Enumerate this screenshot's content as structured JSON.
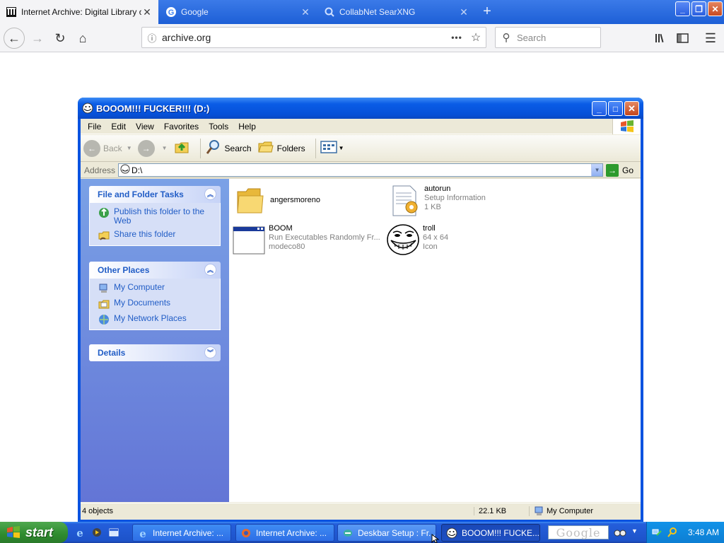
{
  "browser": {
    "tabs": [
      {
        "title": "Internet Archive: Digital Library of",
        "active": true
      },
      {
        "title": "Google",
        "active": false
      },
      {
        "title": "CollabNet SearXNG",
        "active": false
      }
    ],
    "url": "archive.org",
    "search_placeholder": "Search"
  },
  "explorer": {
    "title": "BOOOM!!! FUCKER!!! (D:)",
    "menu": [
      "File",
      "Edit",
      "View",
      "Favorites",
      "Tools",
      "Help"
    ],
    "toolbar": {
      "back": "Back",
      "search": "Search",
      "folders": "Folders"
    },
    "address": {
      "label": "Address",
      "value": "D:\\",
      "go": "Go"
    },
    "panels": {
      "tasks": {
        "title": "File and Folder Tasks",
        "links": [
          "Publish this folder to the Web",
          "Share this folder"
        ]
      },
      "places": {
        "title": "Other Places",
        "links": [
          "My Computer",
          "My Documents",
          "My Network Places"
        ]
      },
      "details": {
        "title": "Details"
      }
    },
    "files": [
      {
        "name": "angersmoreno",
        "line2": "",
        "line3": "",
        "icon": "folder-icon"
      },
      {
        "name": "autorun",
        "line2": "Setup Information",
        "line3": "1 KB",
        "icon": "setup-info-icon"
      },
      {
        "name": "BOOM",
        "line2": "Run Executables Randomly Fr...",
        "line3": "modeco80",
        "icon": "application-icon"
      },
      {
        "name": "troll",
        "line2": "64 x 64",
        "line3": "Icon",
        "icon": "trollface-icon"
      }
    ],
    "status": {
      "objects": "4 objects",
      "size": "22.1 KB",
      "location": "My Computer"
    }
  },
  "taskbar": {
    "start": "start",
    "tasks": [
      {
        "label": "Internet Archive: ...",
        "active": false
      },
      {
        "label": "Internet Archive: ...",
        "active": false
      },
      {
        "label": "Deskbar Setup : Fr...",
        "active": false
      },
      {
        "label": "BOOOM!!! FUCKE...",
        "active": true
      }
    ],
    "google_box": "Google",
    "clock": "3:48 AM"
  }
}
